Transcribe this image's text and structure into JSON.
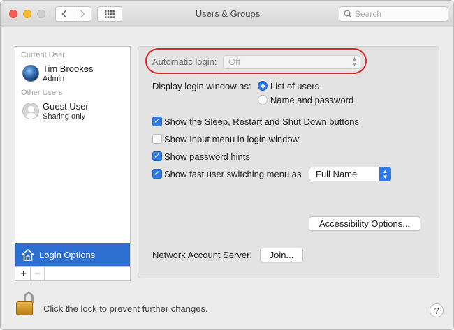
{
  "window": {
    "title": "Users & Groups"
  },
  "toolbar": {
    "search_placeholder": "Search"
  },
  "sidebar": {
    "current_user_label": "Current User",
    "current_user": {
      "name": "Tim Brookes",
      "role": "Admin"
    },
    "other_users_label": "Other Users",
    "other_users": [
      {
        "name": "Guest User",
        "role": "Sharing only"
      }
    ],
    "login_options_label": "Login Options",
    "add_label": "+",
    "remove_label": "−"
  },
  "main": {
    "automatic_login": {
      "label": "Automatic login:",
      "value": "Off",
      "enabled": false
    },
    "display_login_window": {
      "label": "Display login window as:",
      "options": [
        {
          "label": "List of users",
          "selected": true
        },
        {
          "label": "Name and password",
          "selected": false
        }
      ]
    },
    "checkboxes": [
      {
        "label": "Show the Sleep, Restart and Shut Down buttons",
        "checked": true
      },
      {
        "label": "Show Input menu in login window",
        "checked": false
      },
      {
        "label": "Show password hints",
        "checked": true
      },
      {
        "label": "Show fast user switching menu as",
        "checked": true
      }
    ],
    "fast_user_switching_value": "Full Name",
    "accessibility_button": "Accessibility Options...",
    "network_account_label": "Network Account Server:",
    "join_button": "Join..."
  },
  "footer": {
    "lock_text": "Click the lock to prevent further changes.",
    "help_label": "?"
  },
  "colors": {
    "accent": "#2f7ae5",
    "selection": "#2d6fd1",
    "highlight_oval": "#d9262b"
  }
}
